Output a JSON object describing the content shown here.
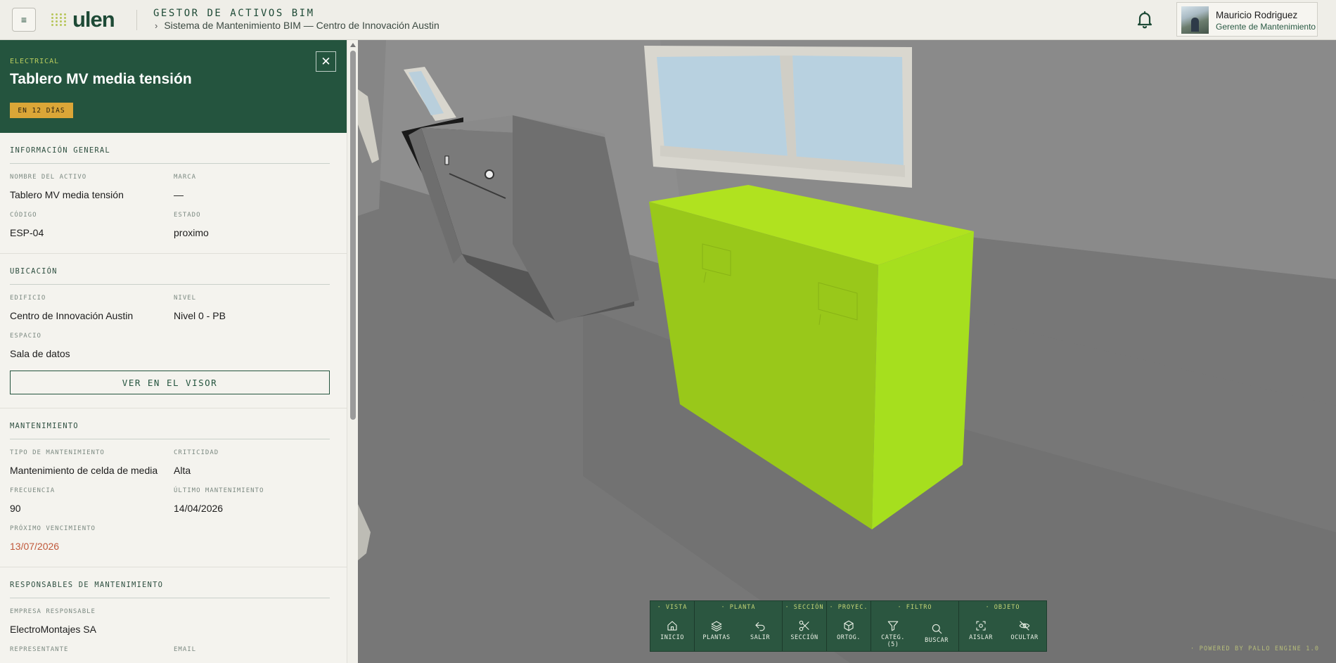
{
  "header": {
    "menu_icon": "≡",
    "logo_text": "ulen",
    "app_title": "GESTOR DE ACTIVOS BIM",
    "breadcrumb_chevron": "›",
    "breadcrumb": "Sistema de Mantenimiento BIM — Centro de Innovación Austin",
    "user": {
      "name": "Mauricio Rodriguez",
      "role": "Gerente de Mantenimiento"
    }
  },
  "panel": {
    "category": "ELECTRICAL",
    "title": "Tablero MV media tensión",
    "due_badge": "EN 12 DÍAS",
    "close_icon": "✕",
    "general": {
      "title": "INFORMACIÓN GENERAL",
      "asset_name_label": "NOMBRE DEL ACTIVO",
      "asset_name": "Tablero MV media tensión",
      "brand_label": "MARCA",
      "brand": "—",
      "code_label": "CÓDIGO",
      "code": "ESP-04",
      "status_label": "ESTADO",
      "status": "proximo"
    },
    "location": {
      "title": "UBICACIÓN",
      "building_label": "EDIFICIO",
      "building": "Centro de Innovación Austin",
      "level_label": "NIVEL",
      "level": "Nivel 0 - PB",
      "space_label": "ESPACIO",
      "space": "Sala de datos",
      "viewer_button": "VER EN EL VISOR"
    },
    "maintenance": {
      "title": "MANTENIMIENTO",
      "type_label": "TIPO DE MANTENIMIENTO",
      "type": "Mantenimiento de celda de media",
      "criticality_label": "CRITICIDAD",
      "criticality": "Alta",
      "frequency_label": "FRECUENCIA",
      "frequency": "90",
      "last_label": "ÚLTIMO MANTENIMIENTO",
      "last": "14/04/2026",
      "next_label": "PRÓXIMO VENCIMIENTO",
      "next": "13/07/2026"
    },
    "responsible": {
      "title": "RESPONSABLES DE MANTENIMIENTO",
      "company_label": "EMPRESA RESPONSABLE",
      "company": "ElectroMontajes SA",
      "rep_label": "REPRESENTANTE",
      "email_label": "EMAIL"
    }
  },
  "toolbar": {
    "groups": [
      {
        "label": "· VISTA",
        "buttons": [
          {
            "label": "INICIO",
            "icon": "home-icon"
          }
        ]
      },
      {
        "label": "· PLANTA",
        "buttons": [
          {
            "label": "PLANTAS",
            "icon": "layers-icon"
          },
          {
            "label": "SALIR",
            "icon": "undo-icon"
          }
        ]
      },
      {
        "label": "· SECCIÓN",
        "buttons": [
          {
            "label": "SECCIÓN",
            "icon": "scissors-icon"
          }
        ]
      },
      {
        "label": "· PROYEC.",
        "buttons": [
          {
            "label": "ORTOG.",
            "icon": "cube-icon"
          }
        ]
      },
      {
        "label": "· FILTRO",
        "buttons": [
          {
            "label": "CATEG. (5)",
            "icon": "filter-icon"
          },
          {
            "label": "BUSCAR",
            "icon": "search-icon"
          }
        ]
      },
      {
        "label": "· OBJETO",
        "buttons": [
          {
            "label": "AISLAR",
            "icon": "focus-icon"
          },
          {
            "label": "OCULTAR",
            "icon": "eye-off-icon"
          }
        ]
      }
    ]
  },
  "viewer": {
    "powered_by": "· POWERED BY PALLO ENGINE 1.0"
  },
  "colors": {
    "brand_green": "#24543e",
    "accent_lime": "#a8de1c",
    "badge_amber": "#dba637",
    "danger": "#c0583a"
  }
}
